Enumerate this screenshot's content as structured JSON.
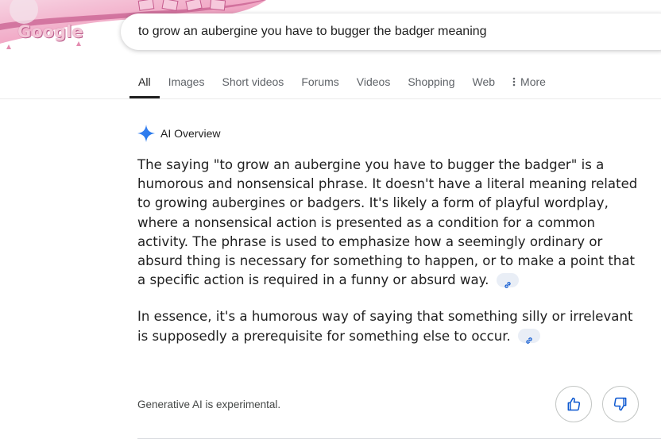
{
  "logo": {
    "text": "Google"
  },
  "search": {
    "query": "to grow an aubergine you have to bugger the badger meaning"
  },
  "tabs": [
    {
      "label": "All",
      "active": true
    },
    {
      "label": "Images"
    },
    {
      "label": "Short videos"
    },
    {
      "label": "Forums"
    },
    {
      "label": "Videos"
    },
    {
      "label": "Shopping"
    },
    {
      "label": "Web"
    },
    {
      "label": "More",
      "icon": "more-vert-icon"
    }
  ],
  "ai_overview": {
    "title": "AI Overview",
    "icon": "sparkle-icon",
    "paragraphs": [
      "The saying \"to grow an aubergine you have to bugger the badger\" is a humorous and nonsensical phrase. It doesn't have a literal meaning related to growing aubergines or badgers. It's likely a form of playful wordplay, where a nonsensical action is presented as a condition for a common activity. The phrase is used to emphasize how a seemingly ordinary or absurd thing is necessary for something to happen, or to make a point that a specific action is required in a funny or absurd way.",
      "In essence, it's a humorous way of saying that something silly or irrelevant is supposedly a prerequisite for something else to occur."
    ],
    "disclaimer": "Generative AI is experimental."
  },
  "colors": {
    "sparkle": "#4285f4",
    "chip_bg": "#e9eef6",
    "link_icon": "#0b57d0"
  }
}
